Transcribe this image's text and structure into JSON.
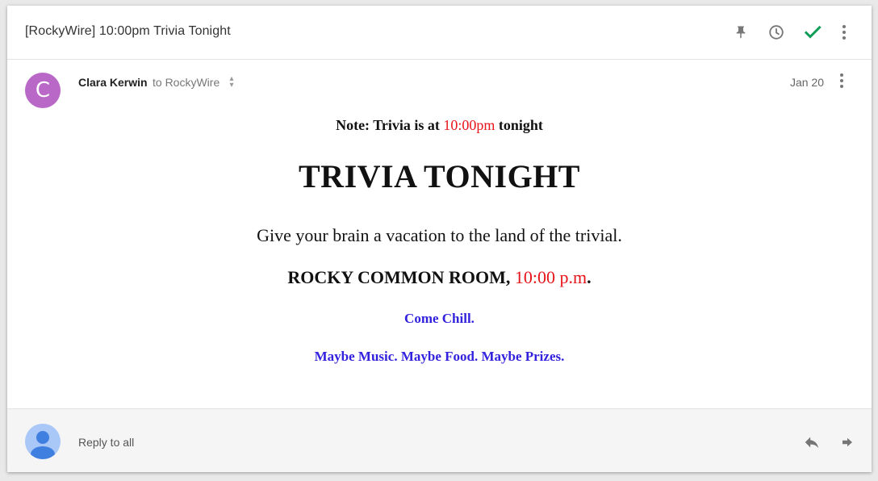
{
  "thread": {
    "subject": "[RockyWire] 10:00pm Trivia Tonight",
    "toolbar": {
      "icons": [
        "pin-icon",
        "clock-icon",
        "check-icon",
        "more-vert-icon"
      ],
      "check_color": "#0f9d58"
    }
  },
  "message": {
    "sender": {
      "avatar_letter": "C",
      "avatar_color": "#ba68c8",
      "name": "Clara Kerwin",
      "to_text": "to RockyWire"
    },
    "date": "Jan 20",
    "body": {
      "note_prefix": "Note: Trivia is at",
      "note_time": "10:00pm",
      "note_suffix": "tonight",
      "headline": "TRIVIA TONIGHT",
      "tagline": "Give your brain a vacation to the land of the trivial.",
      "location": "ROCKY COMMON ROOM,",
      "location_time": "10:00 p.m",
      "location_end": ".",
      "chill": "Come Chill.",
      "maybe": "Maybe Music. Maybe Food. Maybe Prizes.",
      "accent_red": "#e8141a",
      "accent_blue": "#3322dd"
    }
  },
  "reply": {
    "placeholder": "Reply to all",
    "avatar_color": "#a9c8f7",
    "icons": [
      "reply-icon",
      "forward-icon"
    ]
  }
}
